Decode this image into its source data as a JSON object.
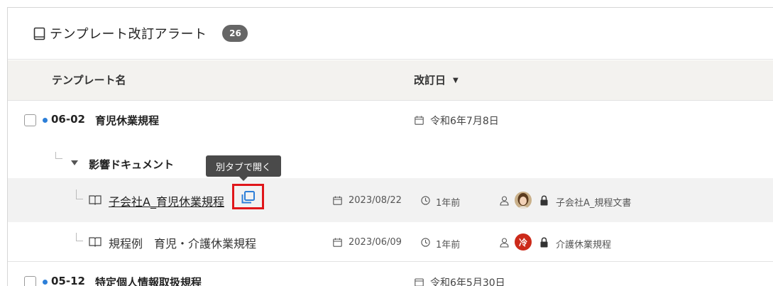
{
  "header": {
    "title": "テンプレート改訂アラート",
    "count": "26",
    "icon": "book-icon"
  },
  "columns": {
    "name": "テンプレート名",
    "date": "改訂日",
    "date_sort": "▼"
  },
  "rows": [
    {
      "code": "06-02",
      "title": "育児休業規程",
      "date": "令和6年7月8日",
      "checked": false,
      "unread": true,
      "impact": {
        "label": "影響ドキュメント",
        "documents": [
          {
            "title": "子会社A_育児休業規程",
            "date": "2023/08/22",
            "age": "1年前",
            "owner_avatar": "photo",
            "folder": "子会社A_規程文書"
          },
          {
            "title": "規程例　育児・介護休業規程",
            "date": "2023/06/09",
            "age": "1年前",
            "owner_avatar": "冷",
            "folder": "介護休業規程"
          }
        ]
      }
    },
    {
      "code": "05-12",
      "title": "特定個人情報取扱規程",
      "date": "令和6年5月30日",
      "checked": false,
      "unread": true
    }
  ],
  "tooltip": {
    "text": "別タブで開く"
  },
  "colors": {
    "accent_dot": "#2d7fd8",
    "highlight_box": "#e0161a",
    "badge_bg": "#666666",
    "header_bg": "#f3f2ef",
    "avatar_red": "#cc2a1a"
  }
}
